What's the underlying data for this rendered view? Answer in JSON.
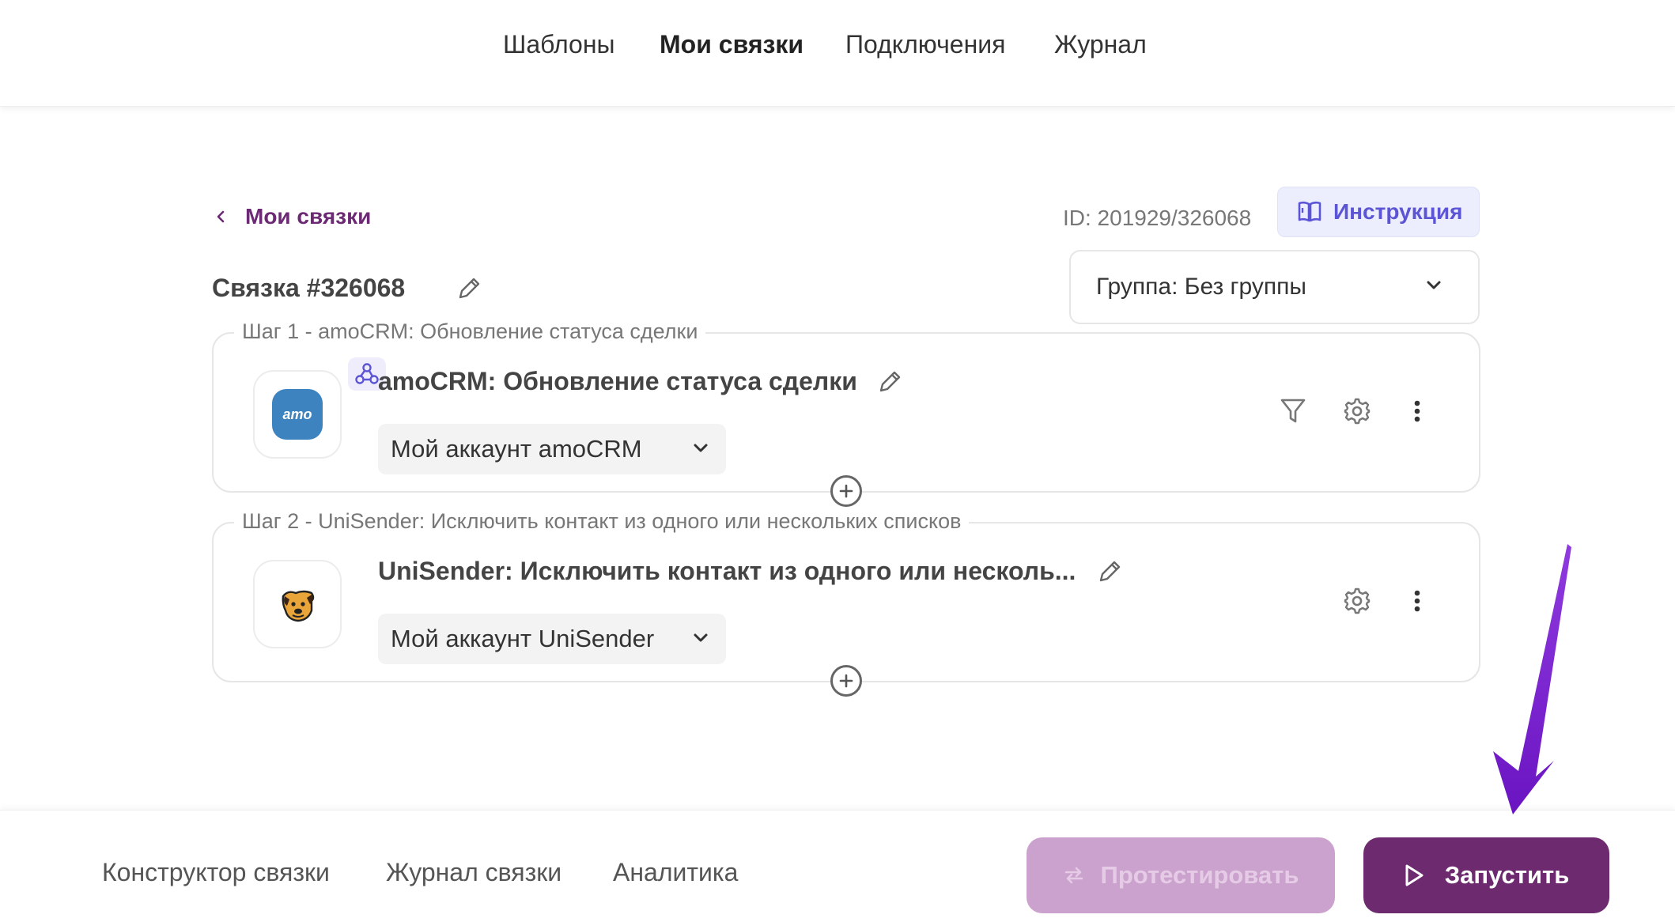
{
  "nav": {
    "items": [
      "Шаблоны",
      "Мои связки",
      "Подключения",
      "Журнал"
    ],
    "active": "Мои связки"
  },
  "header": {
    "back_label": "Мои связки",
    "id_text": "ID: 201929/326068",
    "instruction_label": "Инструкция",
    "title": "Связка #326068",
    "group_label": "Группа: Без группы"
  },
  "steps": [
    {
      "legend": "Шаг 1 - amoCRM: Обновление статуса сделки",
      "title": "amoCRM: Обновление статуса сделки",
      "app_logo_text": "amo",
      "account": "Мой аккаунт amoCRM",
      "icons": [
        "webhook-icon",
        "filter-icon",
        "gear-icon",
        "more-vertical-icon"
      ]
    },
    {
      "legend": "Шаг 2 - UniSender: Исключить контакт из одного или нескольких списков",
      "title": "UniSender: Исключить контакт из одного или несколь...",
      "account": "Мой аккаунт UniSender",
      "icons": [
        "gear-icon",
        "more-vertical-icon"
      ]
    }
  ],
  "bottom": {
    "tabs": [
      "Конструктор связки",
      "Журнал связки",
      "Аналитика"
    ],
    "test_label": "Протестировать",
    "run_label": "Запустить"
  },
  "colors": {
    "accent": "#6e2a6e",
    "accent_disabled": "#cba2cd",
    "link": "#6b2a73",
    "instruction": "#5b55d6",
    "arrow": "#7b1fd1"
  }
}
